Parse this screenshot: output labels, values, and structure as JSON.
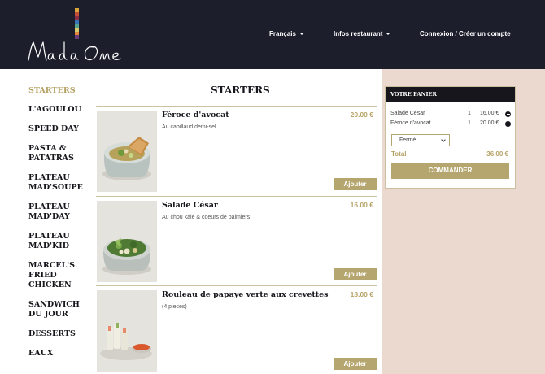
{
  "header": {
    "logo": {
      "name": "Mada One",
      "bar_colors": [
        "#d9a43a",
        "#c44d3a",
        "#8a2e4a",
        "#3a73b5",
        "#58a28c",
        "#d7c96b",
        "#e4873d",
        "#6e3b7a"
      ]
    },
    "nav": {
      "language": "Français",
      "infos": "Infos restaurant",
      "account": "Connexion / Créer un compte"
    }
  },
  "sidebar": {
    "items": [
      {
        "label": "STARTERS",
        "active": true
      },
      {
        "label": "L'AGOULOU"
      },
      {
        "label": "SPEED DAY"
      },
      {
        "label": "PASTA & PATATRAS"
      },
      {
        "label": "PLATEAU MAD'SOUPE"
      },
      {
        "label": "PLATEAU MAD'DAY"
      },
      {
        "label": "PLATEAU MAD'KID"
      },
      {
        "label": "MARCEL'S FRIED CHICKEN"
      },
      {
        "label": "SANDWICH DU JOUR"
      },
      {
        "label": "DESSERTS"
      },
      {
        "label": "EAUX"
      }
    ]
  },
  "main": {
    "section_title": "STARTERS",
    "products": [
      {
        "name": "Féroce d'avocat",
        "desc": "Au cabillaud demi-sel",
        "price": "20.00 €",
        "add_label": "Ajouter"
      },
      {
        "name": "Salade César",
        "desc": "Au chou kalé & coeurs de palmiers",
        "price": "16.00 €",
        "add_label": "Ajouter"
      },
      {
        "name": "Rouleau de papaye verte aux crevettes",
        "desc": "(4 pieces)",
        "price": "18.00 €",
        "add_label": "Ajouter"
      }
    ]
  },
  "cart": {
    "title": "VOTRE PANIER",
    "items": [
      {
        "name": "Salade César",
        "qty": "1",
        "price": "16.00 €"
      },
      {
        "name": "Féroce d'avocat",
        "qty": "1",
        "price": "20.00 €"
      }
    ],
    "status_select": "Fermé",
    "total_label": "Total",
    "total_value": "36.00 €",
    "order_label": "COMMANDER"
  },
  "colors": {
    "header_bg": "#1c1e2c",
    "accent_gold": "#b5a56e",
    "panel_bg": "#ebd9cf"
  }
}
